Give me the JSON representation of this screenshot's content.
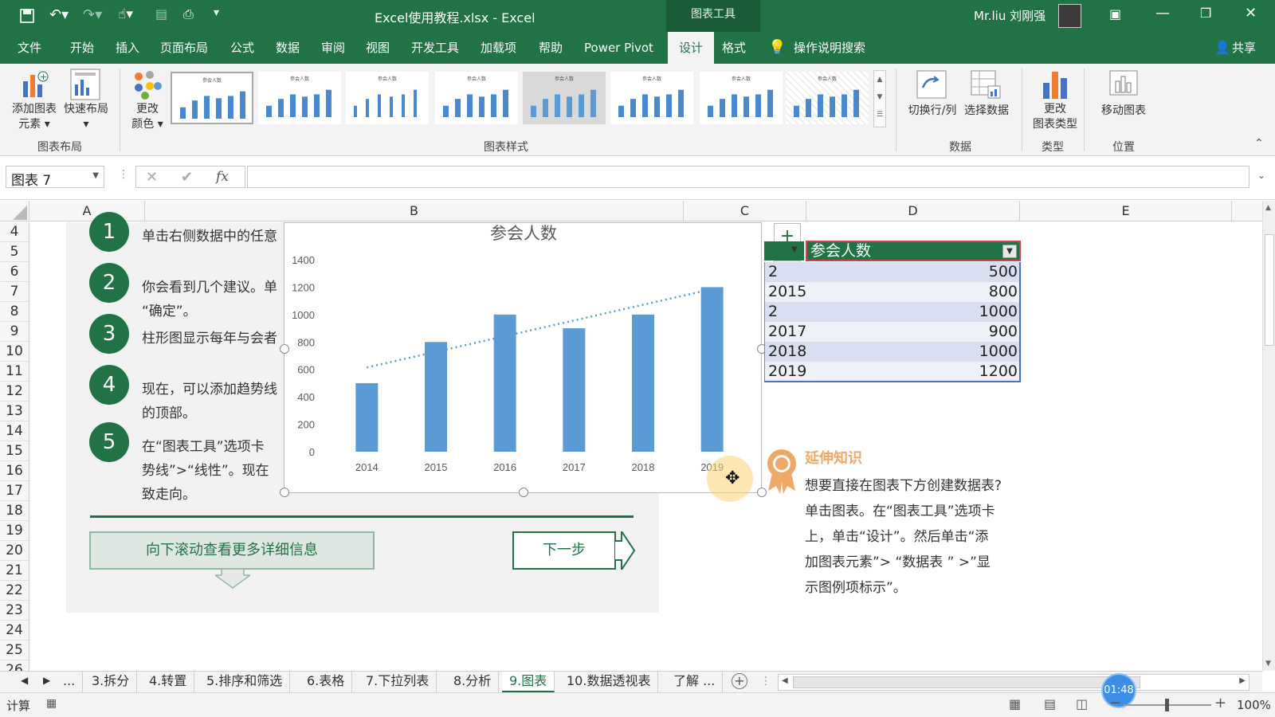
{
  "window": {
    "title": "Excel使用教程.xlsx  -  Excel",
    "context_tab": "图表工具",
    "user": "Mr.liu 刘刚强"
  },
  "tabs": [
    "文件",
    "开始",
    "插入",
    "页面布局",
    "公式",
    "数据",
    "审阅",
    "视图",
    "开发工具",
    "加载项",
    "帮助",
    "Power Pivot",
    "设计",
    "格式"
  ],
  "tell_me": "操作说明搜索",
  "share": "共享",
  "ribbon": {
    "add_element": "添加图表\n元素 ▾",
    "quick_layout": "快速布局\n▾",
    "change_color": "更改\n颜色 ▾",
    "switch_row_col": "切换行/列",
    "select_data": "选择数据",
    "change_type": "更改\n图表类型",
    "move_chart": "移动图表",
    "groups": {
      "layout": "图表布局",
      "styles": "图表样式",
      "data": "数据",
      "type": "类型",
      "location": "位置"
    },
    "style_thumb_title": "参会人数"
  },
  "namebox": "图表 7",
  "fx": "fx",
  "columns": [
    "A",
    "B",
    "C",
    "D",
    "E"
  ],
  "rows": [
    "4",
    "5",
    "6",
    "7",
    "8",
    "9",
    "10",
    "11",
    "12",
    "13",
    "14",
    "15",
    "16",
    "17",
    "18",
    "19",
    "20",
    "21",
    "22",
    "23",
    "24",
    "25",
    "26"
  ],
  "steps": [
    {
      "num": "1",
      "lines": [
        "单击右侧数据中的任意"
      ]
    },
    {
      "num": "2",
      "lines": [
        "你会看到几个建议。单",
        "“确定”。"
      ]
    },
    {
      "num": "3",
      "lines": [
        "柱形图显示每年与会者"
      ]
    },
    {
      "num": "4",
      "lines": [
        "现在，可以添加趋势线",
        "的顶部。"
      ]
    },
    {
      "num": "5",
      "lines": [
        "在“图表工具”选项卡",
        "势线”>“线性”。现在",
        "致走向。"
      ]
    }
  ],
  "buttons": {
    "scroll": "向下滚动查看更多详细信息",
    "next": "下一步"
  },
  "chart_data": {
    "type": "bar",
    "title": "参会人数",
    "categories": [
      "2014",
      "2015",
      "2016",
      "2017",
      "2018",
      "2019"
    ],
    "values": [
      500,
      800,
      1000,
      900,
      1000,
      1200
    ],
    "ylim": [
      0,
      1400
    ],
    "yticks": [
      0,
      200,
      400,
      600,
      800,
      1000,
      1200,
      1400
    ],
    "trendline": "linear",
    "bar_color": "#5b9bd5",
    "xlabel": "",
    "ylabel": ""
  },
  "chart_tools": {
    "plus": "+",
    "brush": "✎",
    "filter": "⛉"
  },
  "table": {
    "header": "参会人数",
    "rows": [
      {
        "year": "2",
        "value": "500"
      },
      {
        "year": "2015",
        "value": "800"
      },
      {
        "year": "2",
        "value": "1000"
      },
      {
        "year": "2017",
        "value": "900"
      },
      {
        "year": "2018",
        "value": "1000"
      },
      {
        "year": "2019",
        "value": "1200"
      }
    ]
  },
  "extend": {
    "title": "延伸知识",
    "lines": [
      "想要直接在图表下方创建数据表?",
      "单击图表。在“图表工具”选项卡",
      "上，单击“设计”。然后单击“添",
      "加图表元素”> “数据表 ” >”显",
      "示图例项标示”。"
    ]
  },
  "sheets": [
    "...",
    "3.拆分",
    "4.转置",
    "5.排序和筛选",
    "6.表格",
    "7.下拉列表",
    "8.分析",
    "9.图表",
    "10.数据透视表",
    "了解 ..."
  ],
  "active_sheet": "9.图表",
  "status": {
    "mode": "计算",
    "timer": "01:48",
    "zoom": "100%"
  },
  "colors": {
    "excel_green": "#217346",
    "bar": "#5b9bd5",
    "extend_orange": "#f0a868"
  }
}
